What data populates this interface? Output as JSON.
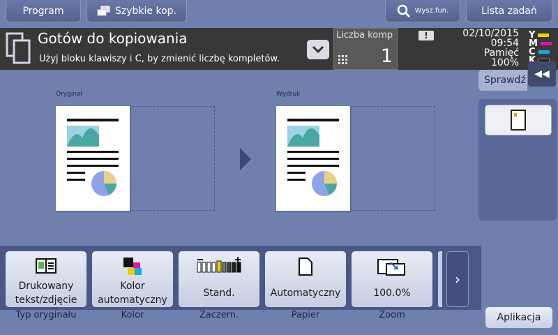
{
  "topbar": {
    "program": "Program",
    "quick_copy": "Szybkie kop.",
    "search_function": "Wysz.fun.",
    "job_list": "Lista zadań"
  },
  "status": {
    "title": "Gotów do kopiowania",
    "hint": "Użyj bloku klawiszy i C, by zmienić liczbę kompletów.",
    "copies_label": "Liczba komp",
    "copies_value": "1",
    "alert_glyph": "!",
    "date": "02/10/2015",
    "time": "09:54",
    "memory_label": "Pamięć",
    "memory_value": "100%"
  },
  "toner": [
    {
      "letter": "Y",
      "color": "#f0d000"
    },
    {
      "letter": "M",
      "color": "#e0169c"
    },
    {
      "letter": "C",
      "color": "#18a9e0"
    },
    {
      "letter": "K",
      "color": "#202020"
    }
  ],
  "side": {
    "check": "Sprawdź",
    "collapse_glyph": "◀◀"
  },
  "preview": {
    "original_label": "Oryginał",
    "output_label": "Wydruk"
  },
  "functions": [
    {
      "value_line1": "Drukowany",
      "value_line2": "tekst/zdjęcie",
      "label": "Typ oryginału",
      "icon": "text-photo-icon"
    },
    {
      "value_line1": "Kolor",
      "value_line2": "automatyczny",
      "label": "Kolor",
      "icon": "color-cmyk-icon"
    },
    {
      "value_line1": "Stand.",
      "value_line2": "",
      "label": "Zaczern.",
      "icon": "density-icon"
    },
    {
      "value_line1": "Automatyczny",
      "value_line2": "",
      "label": "Papier",
      "icon": "paper-icon"
    },
    {
      "value_line1": "100.0%",
      "value_line2": "",
      "label": "Zoom",
      "icon": "zoom-icon"
    }
  ],
  "more_glyph": "›",
  "application": "Aplikacja"
}
